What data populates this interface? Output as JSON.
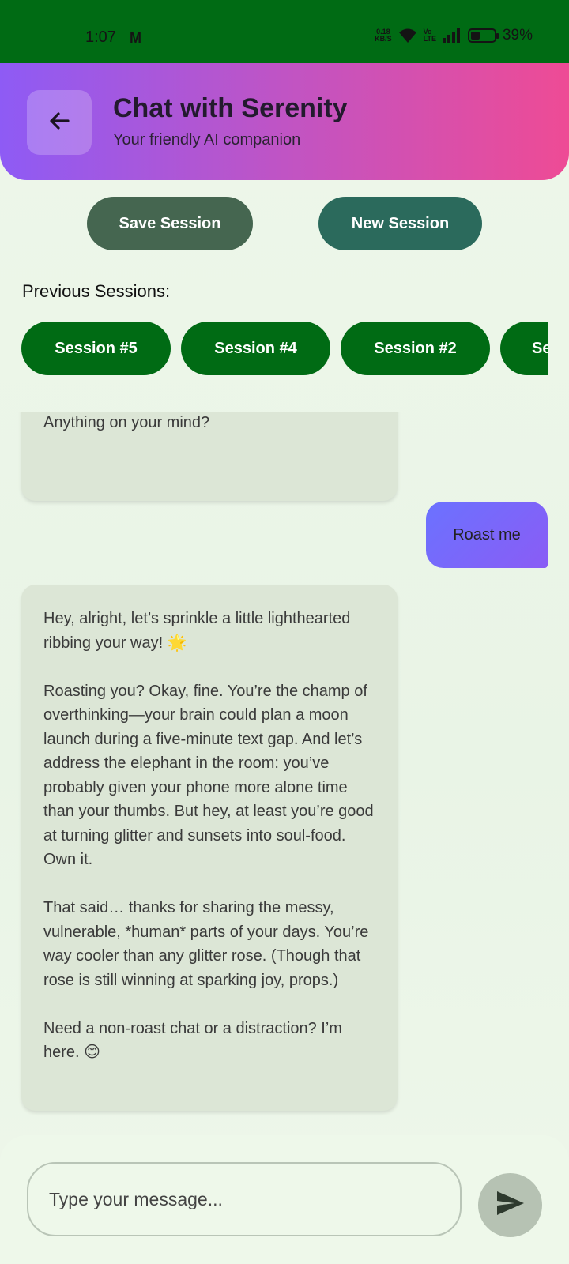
{
  "status_bar": {
    "time": "1:07",
    "mail_icon_glyph": "M",
    "net_speed_value": "0.18",
    "net_speed_unit": "KB/S",
    "volte_top": "Vo",
    "volte_bottom": "LTE",
    "battery_percent": "39%",
    "battery_level": 0.39,
    "icons": [
      "gmail-icon",
      "wifi-icon",
      "signal-icon",
      "battery-icon"
    ]
  },
  "header": {
    "title": "Chat with Serenity",
    "subtitle": "Your friendly AI companion",
    "back_icon": "arrow-left-icon",
    "gradient": [
      "#8e5bf5",
      "#ee4b95"
    ]
  },
  "actions": {
    "save_label": "Save Session",
    "new_label": "New Session"
  },
  "sessions": {
    "label": "Previous Sessions:",
    "items": [
      "Session #5",
      "Session #4",
      "Session #2",
      "Se"
    ]
  },
  "chat": {
    "messages": [
      {
        "sender": "bot",
        "text": "Anything on your mind?"
      },
      {
        "sender": "user",
        "text": "Roast me"
      },
      {
        "sender": "bot",
        "text": "Hey, alright, let’s sprinkle a little lighthearted ribbing your way! 🌟\n\nRoasting you? Okay, fine. You’re the champ of overthinking—your brain could plan a moon launch during a five-minute text gap. And let’s address the elephant in the room: you’ve probably given your phone more alone time than your thumbs. But hey, at least you’re good at turning glitter and sunsets into soul-food. Own it.\n\nThat said… thanks for sharing the messy, vulnerable, *human* parts of your days. You’re way cooler than any glitter rose. (Though that rose is still winning at sparking joy, props.)\n\nNeed a non-roast chat or a distraction? I’m here. 😊"
      }
    ]
  },
  "composer": {
    "placeholder": "Type your message...",
    "send_icon": "send-icon"
  },
  "colors": {
    "status_bar": "#006b14",
    "session_chip": "#006b14",
    "save_button": "#456650",
    "new_button": "#2b6a5c",
    "bot_bubble": "#dce6d6",
    "user_bubble": "#6b72ff",
    "send_button": "#b6c2b3"
  }
}
